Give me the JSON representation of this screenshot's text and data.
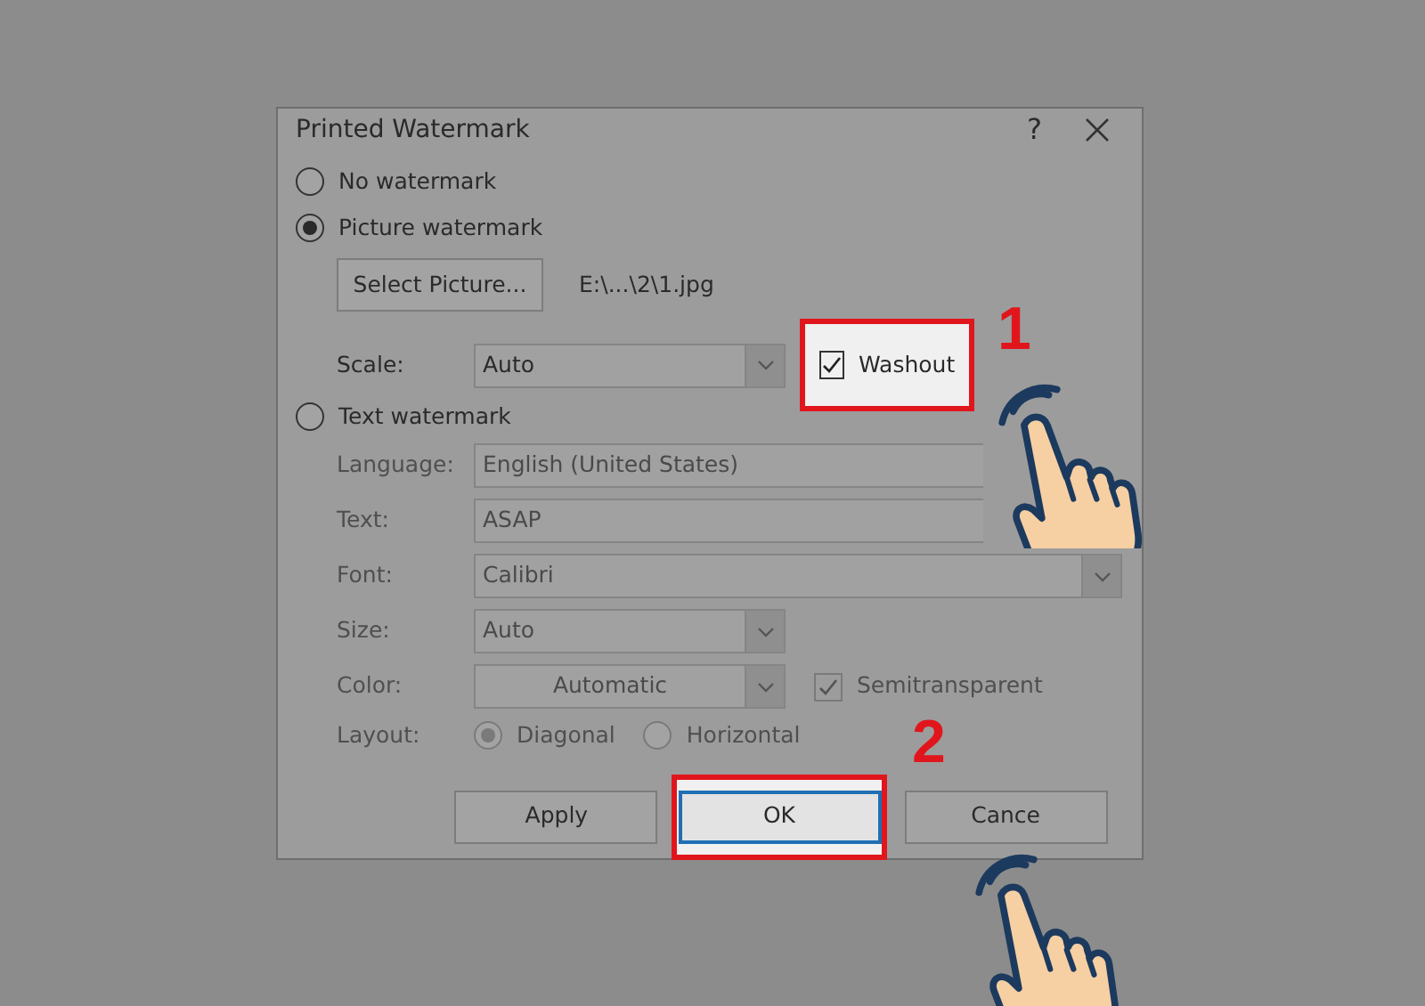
{
  "dialog": {
    "title": "Printed Watermark",
    "help": "?"
  },
  "options": [
    {
      "label": "No watermark",
      "selected": false
    },
    {
      "label": "Picture watermark",
      "selected": true
    },
    {
      "label": "Text watermark",
      "selected": false
    }
  ],
  "picture": {
    "button": "Select Picture...",
    "path": "E:\\...\\2\\1.jpg",
    "scale_label": "Scale:",
    "scale_value": "Auto",
    "washout": {
      "label": "Washout",
      "checked": true,
      "highlighted": true
    }
  },
  "text_settings": [
    {
      "label": "Language:",
      "kind": "field",
      "value": "English (United States)"
    },
    {
      "label": "Text:",
      "kind": "field",
      "value": "ASAP"
    },
    {
      "label": "Font:",
      "kind": "wide-combo",
      "value": "Calibri"
    },
    {
      "label": "Size:",
      "kind": "combo",
      "value": "Auto"
    },
    {
      "label": "Color:",
      "kind": "color",
      "value": "Automatic",
      "check": {
        "label": "Semitransparent",
        "checked": true
      }
    },
    {
      "label": "Layout:",
      "kind": "radios",
      "choices": [
        {
          "label": "Diagonal",
          "selected": true
        },
        {
          "label": "Horizontal",
          "selected": false
        }
      ]
    }
  ],
  "buttons": [
    {
      "label": "Apply",
      "highlighted": false
    },
    {
      "label": "OK",
      "highlighted": true
    },
    {
      "label": "Cance",
      "highlighted": false
    }
  ],
  "annotations": [
    {
      "number": "1"
    },
    {
      "number": "2"
    }
  ]
}
